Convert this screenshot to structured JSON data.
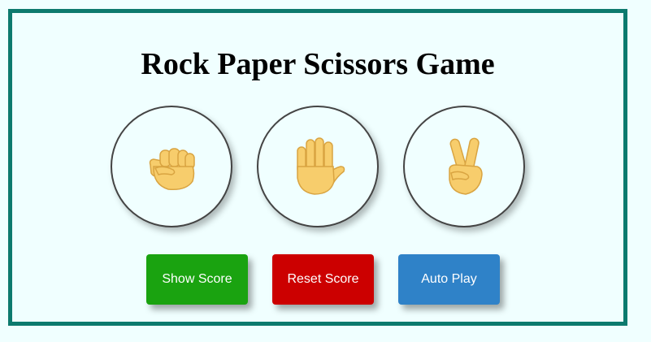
{
  "game": {
    "title": "Rock Paper Scissors Game"
  },
  "choices": [
    {
      "name": "rock",
      "icon": "raised-fist-icon"
    },
    {
      "name": "paper",
      "icon": "raised-hand-icon"
    },
    {
      "name": "scissors",
      "icon": "victory-hand-icon"
    }
  ],
  "buttons": {
    "show_score": "Show Score",
    "reset_score": "Reset Score",
    "auto_play": "Auto Play"
  },
  "colors": {
    "frame_border": "#0d7a6e",
    "background": "#f0ffff",
    "show_score_button": "#1aa310",
    "reset_score_button": "#cc0000",
    "auto_play_button": "#2f82c8",
    "hand_skin": "#f7cd6c"
  }
}
